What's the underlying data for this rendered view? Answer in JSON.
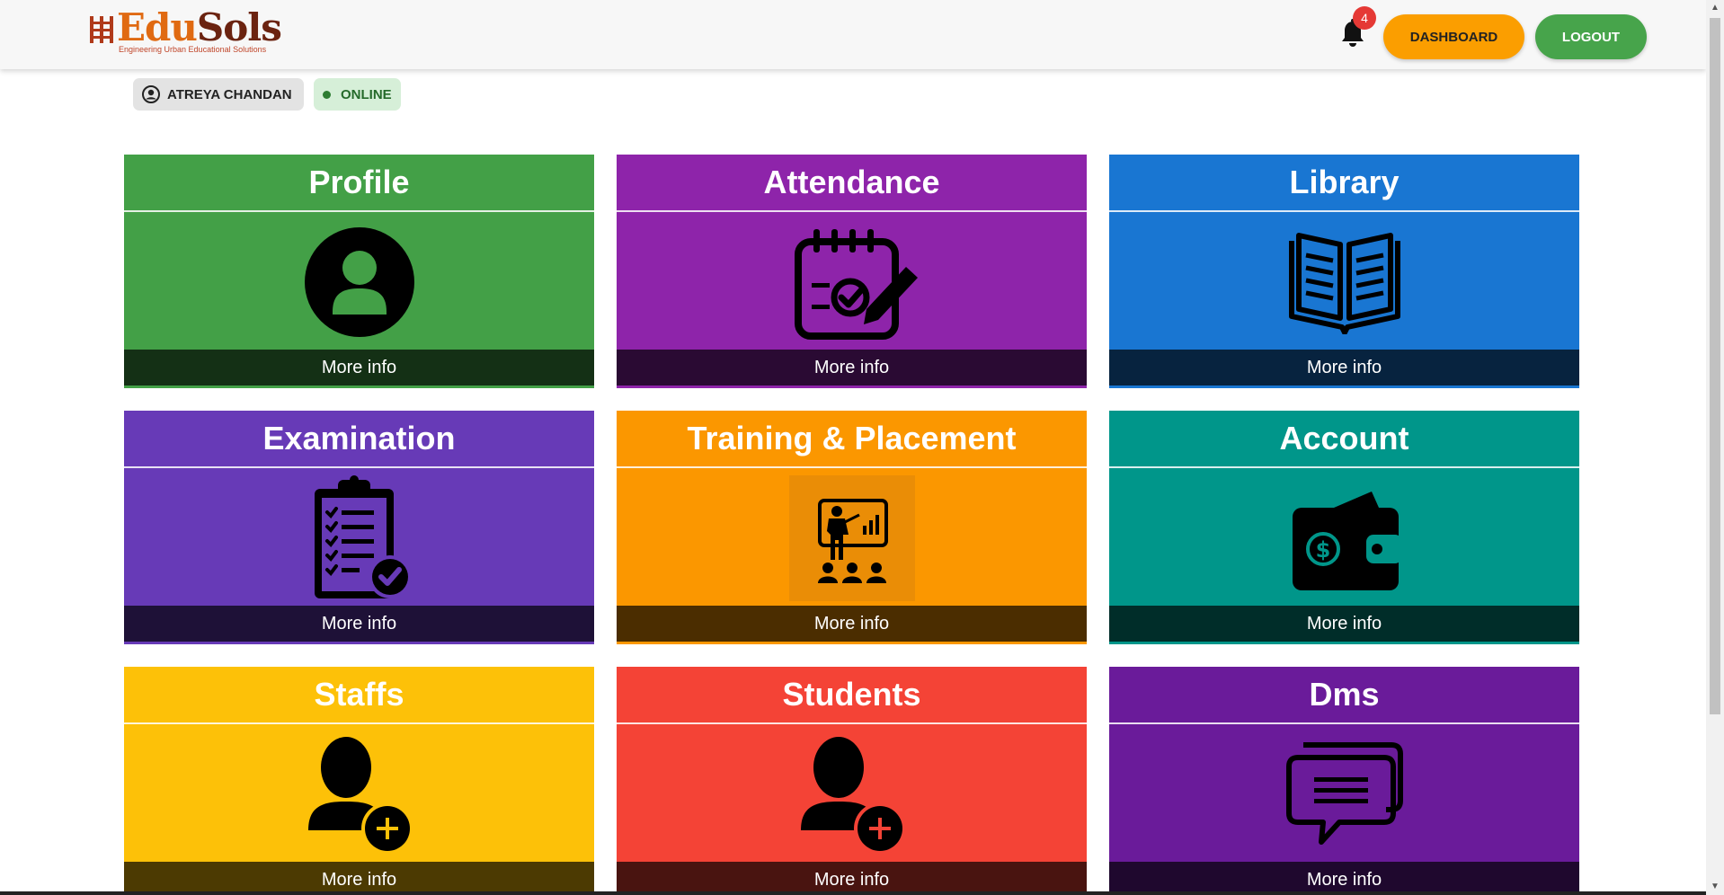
{
  "header": {
    "brand_edu": "Edu",
    "brand_sols": "Sols",
    "tagline": "Engineering Urban Educational Solutions",
    "notification_count": "4",
    "dashboard_label": "DASHBOARD",
    "logout_label": "LOGOUT"
  },
  "status": {
    "user_name": "ATREYA CHANDAN",
    "online_label": "ONLINE"
  },
  "tiles": [
    {
      "title": "Profile",
      "more": "More info",
      "icon": "user-circle-icon",
      "color": "#43a047"
    },
    {
      "title": "Attendance",
      "more": "More info",
      "icon": "calendar-check-edit-icon",
      "color": "#8e24aa"
    },
    {
      "title": "Library",
      "more": "More info",
      "icon": "open-book-icon",
      "color": "#1976d2"
    },
    {
      "title": "Examination",
      "more": "More info",
      "icon": "clipboard-checklist-icon",
      "color": "#673ab7"
    },
    {
      "title": "Training & Placement",
      "more": "More info",
      "icon": "presentation-icon",
      "color": "#fb9700"
    },
    {
      "title": "Account",
      "more": "More info",
      "icon": "wallet-dollar-icon",
      "color": "#00968a"
    },
    {
      "title": "Staffs",
      "more": "More info",
      "icon": "user-add-icon",
      "color": "#fdc108"
    },
    {
      "title": "Students",
      "more": "More info",
      "icon": "user-add-icon",
      "color": "#f44336"
    },
    {
      "title": "Dms",
      "more": "More info",
      "icon": "chat-bubbles-icon",
      "color": "#6a1b9a"
    }
  ]
}
